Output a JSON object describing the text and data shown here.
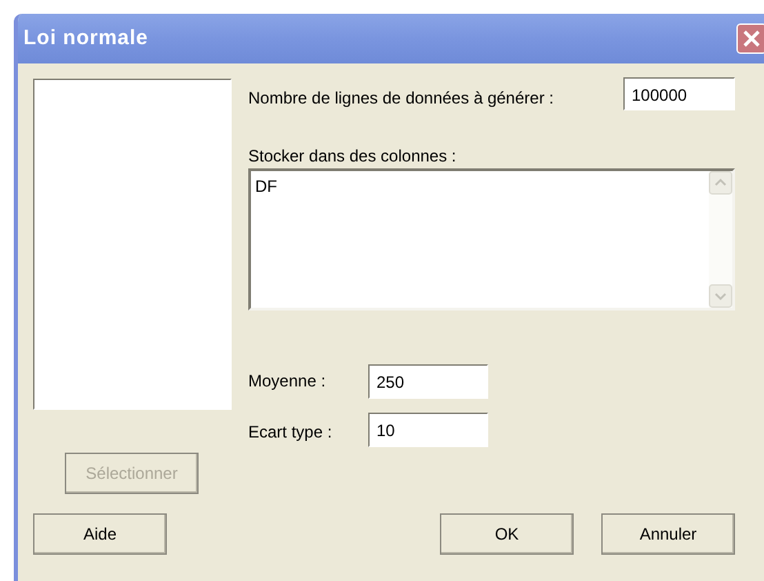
{
  "window": {
    "title": "Loi normale"
  },
  "select_button": {
    "label": "Sélectionner",
    "disabled": true
  },
  "rows_field": {
    "label": "Nombre de lignes de données à générer :",
    "value": "100000"
  },
  "columns_field": {
    "label": "Stocker dans des colonnes :",
    "value": "DF"
  },
  "mean_field": {
    "label": "Moyenne :",
    "value": "250"
  },
  "sd_field": {
    "label": "Ecart type :",
    "value": "10"
  },
  "buttons": [
    {
      "label": "Aide",
      "kind": "help"
    },
    {
      "label": "OK",
      "kind": "ok"
    },
    {
      "label": "Annuler",
      "kind": "cancel"
    }
  ]
}
